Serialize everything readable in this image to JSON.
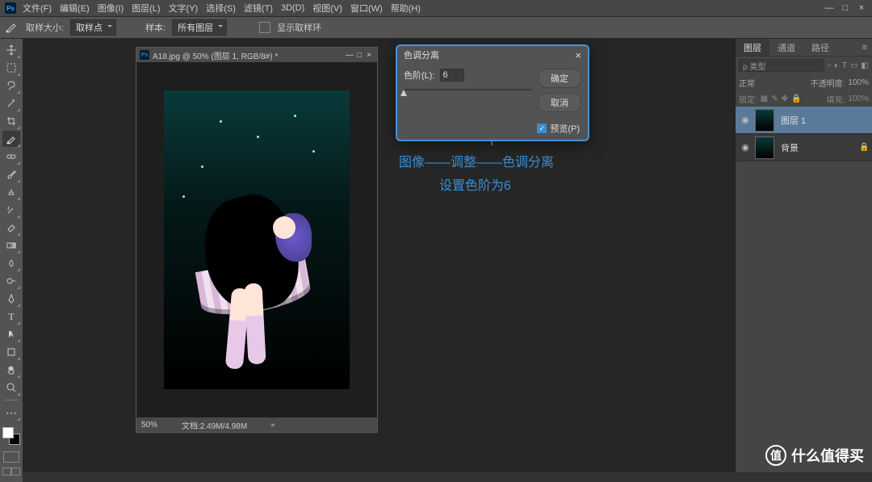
{
  "menu": {
    "file": "文件(F)",
    "edit": "编辑(E)",
    "image": "图像(I)",
    "layer": "图层(L)",
    "text": "文字(Y)",
    "select": "选择(S)",
    "filter": "滤镜(T)",
    "threed": "3D(D)",
    "view": "视图(V)",
    "window": "窗口(W)",
    "help": "帮助(H)"
  },
  "winctrl": {
    "min": "—",
    "max": "□",
    "close": "×"
  },
  "options": {
    "sample_size_label": "取样大小:",
    "sample_size_value": "取样点",
    "sample_label": "样本:",
    "sample_value": "所有图层",
    "rings": "显示取样环"
  },
  "doc": {
    "title": "A18.jpg @ 50% (图层 1, RGB/8#) *",
    "zoom": "50%",
    "docinfo": "文档:2.49M/4.98M"
  },
  "dialog": {
    "title": "色调分离",
    "levels_label": "色阶(L):",
    "levels_value": "6",
    "ok": "确定",
    "cancel": "取消",
    "preview": "预览(P)"
  },
  "annot": {
    "line1": "图像——调整——色调分离",
    "line2": "设置色阶为6"
  },
  "panels": {
    "tabs": {
      "layers": "图层",
      "channels": "通道",
      "paths": "路径"
    },
    "kind": "ρ 类型",
    "blend": "正常",
    "opacity_label": "不透明度:",
    "opacity": "100%",
    "lock_label": "锁定:",
    "fill_label": "填充:",
    "fill": "100%",
    "layer1": "图层 1",
    "bg": "背景"
  },
  "watermark": {
    "icon": "值",
    "text": "什么值得买"
  }
}
